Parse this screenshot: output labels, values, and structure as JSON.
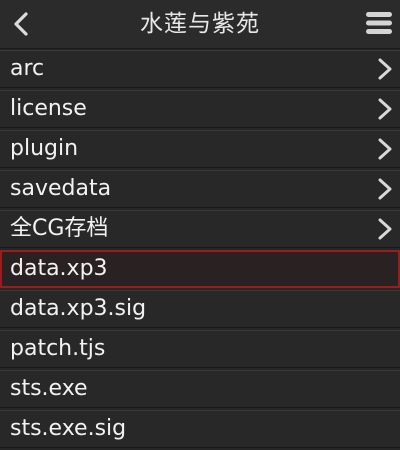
{
  "header": {
    "title": "水莲与紫苑",
    "back_icon": "chevron-left-icon",
    "menu_icon": "hamburger-menu-icon"
  },
  "colors": {
    "background": "#262626",
    "text": "#f2f2f2",
    "selection_border": "#9b1c1c"
  },
  "list": {
    "items": [
      {
        "label": "arc",
        "type": "folder",
        "selected": false
      },
      {
        "label": "license",
        "type": "folder",
        "selected": false
      },
      {
        "label": "plugin",
        "type": "folder",
        "selected": false
      },
      {
        "label": "savedata",
        "type": "folder",
        "selected": false
      },
      {
        "label": "全CG存档",
        "type": "folder",
        "selected": false
      },
      {
        "label": "data.xp3",
        "type": "file",
        "selected": true
      },
      {
        "label": "data.xp3.sig",
        "type": "file",
        "selected": false
      },
      {
        "label": "patch.tjs",
        "type": "file",
        "selected": false
      },
      {
        "label": "sts.exe",
        "type": "file",
        "selected": false
      },
      {
        "label": "sts.exe.sig",
        "type": "file",
        "selected": false
      }
    ]
  }
}
